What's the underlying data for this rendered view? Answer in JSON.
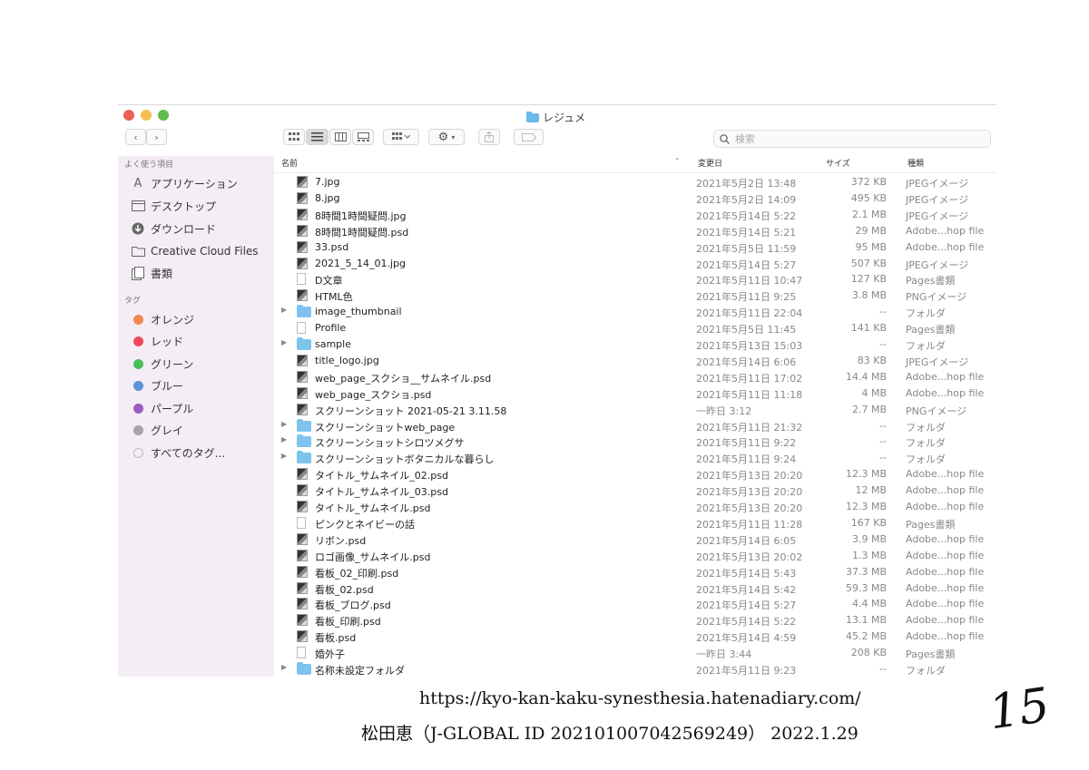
{
  "window": {
    "title": "レジュメ"
  },
  "toolbar": {
    "search_placeholder": "検索",
    "back_label": "‹",
    "forward_label": "›"
  },
  "sidebar": {
    "favorites_header": "よく使う項目",
    "favorites": [
      {
        "label": "アプリケーション",
        "icon": "applications-icon"
      },
      {
        "label": "デスクトップ",
        "icon": "desktop-icon"
      },
      {
        "label": "ダウンロード",
        "icon": "downloads-icon"
      },
      {
        "label": "Creative Cloud Files",
        "icon": "folder-icon"
      },
      {
        "label": "書類",
        "icon": "documents-icon"
      }
    ],
    "tags_header": "タグ",
    "tags": [
      {
        "label": "オレンジ",
        "color": "#f0874f"
      },
      {
        "label": "レッド",
        "color": "#ec4a5c"
      },
      {
        "label": "グリーン",
        "color": "#4cbf57"
      },
      {
        "label": "ブルー",
        "color": "#5a92d8"
      },
      {
        "label": "パープル",
        "color": "#9b5cc1"
      },
      {
        "label": "グレイ",
        "color": "#a5a5ab"
      },
      {
        "label": "すべてのタグ...",
        "color": ""
      }
    ]
  },
  "columns": {
    "name": "名前",
    "date": "変更日",
    "size": "サイズ",
    "kind": "種類"
  },
  "files": [
    {
      "name": "7.jpg",
      "date": "2021年5月2日 13:48",
      "size": "372 KB",
      "kind": "JPEGイメージ",
      "type": "image"
    },
    {
      "name": "8.jpg",
      "date": "2021年5月2日 14:09",
      "size": "495 KB",
      "kind": "JPEGイメージ",
      "type": "image"
    },
    {
      "name": "8時間1時間疑問.jpg",
      "date": "2021年5月14日 5:22",
      "size": "2.1 MB",
      "kind": "JPEGイメージ",
      "type": "image"
    },
    {
      "name": "8時間1時間疑問.psd",
      "date": "2021年5月14日 5:21",
      "size": "29 MB",
      "kind": "Adobe...hop file",
      "type": "image"
    },
    {
      "name": "33.psd",
      "date": "2021年5月5日 11:59",
      "size": "95 MB",
      "kind": "Adobe...hop file",
      "type": "image"
    },
    {
      "name": "2021_5_14_01.jpg",
      "date": "2021年5月14日 5:27",
      "size": "507 KB",
      "kind": "JPEGイメージ",
      "type": "image"
    },
    {
      "name": "D文章",
      "date": "2021年5月11日 10:47",
      "size": "127 KB",
      "kind": "Pages書類",
      "type": "file"
    },
    {
      "name": "HTML色",
      "date": "2021年5月11日 9:25",
      "size": "3.8 MB",
      "kind": "PNGイメージ",
      "type": "image"
    },
    {
      "name": "image_thumbnail",
      "date": "2021年5月11日 22:04",
      "size": "--",
      "kind": "フォルダ",
      "type": "folder"
    },
    {
      "name": "Profile",
      "date": "2021年5月5日 11:45",
      "size": "141 KB",
      "kind": "Pages書類",
      "type": "file"
    },
    {
      "name": "sample",
      "date": "2021年5月13日 15:03",
      "size": "--",
      "kind": "フォルダ",
      "type": "folder"
    },
    {
      "name": "title_logo.jpg",
      "date": "2021年5月14日 6:06",
      "size": "83 KB",
      "kind": "JPEGイメージ",
      "type": "image"
    },
    {
      "name": "web_page_スクショ__サムネイル.psd",
      "date": "2021年5月11日 17:02",
      "size": "14.4 MB",
      "kind": "Adobe...hop file",
      "type": "image"
    },
    {
      "name": "web_page_スクショ.psd",
      "date": "2021年5月11日 11:18",
      "size": "4 MB",
      "kind": "Adobe...hop file",
      "type": "image"
    },
    {
      "name": "スクリーンショット 2021-05-21 3.11.58",
      "date": "一昨日 3:12",
      "size": "2.7 MB",
      "kind": "PNGイメージ",
      "type": "image"
    },
    {
      "name": "スクリーンショットweb_page",
      "date": "2021年5月11日 21:32",
      "size": "--",
      "kind": "フォルダ",
      "type": "folder"
    },
    {
      "name": "スクリーンショットシロツメグサ",
      "date": "2021年5月11日 9:22",
      "size": "--",
      "kind": "フォルダ",
      "type": "folder"
    },
    {
      "name": "スクリーンショットボタニカルな暮らし",
      "date": "2021年5月11日 9:24",
      "size": "--",
      "kind": "フォルダ",
      "type": "folder"
    },
    {
      "name": "タイトル_サムネイル_02.psd",
      "date": "2021年5月13日 20:20",
      "size": "12.3 MB",
      "kind": "Adobe...hop file",
      "type": "image"
    },
    {
      "name": "タイトル_サムネイル_03.psd",
      "date": "2021年5月13日 20:20",
      "size": "12 MB",
      "kind": "Adobe...hop file",
      "type": "image"
    },
    {
      "name": "タイトル_サムネイル.psd",
      "date": "2021年5月13日 20:20",
      "size": "12.3 MB",
      "kind": "Adobe...hop file",
      "type": "image"
    },
    {
      "name": "ピンクとネイビーの話",
      "date": "2021年5月11日 11:28",
      "size": "167 KB",
      "kind": "Pages書類",
      "type": "file"
    },
    {
      "name": "リボン.psd",
      "date": "2021年5月14日 6:05",
      "size": "3.9 MB",
      "kind": "Adobe...hop file",
      "type": "image"
    },
    {
      "name": "ロゴ画像_サムネイル.psd",
      "date": "2021年5月13日 20:02",
      "size": "1.3 MB",
      "kind": "Adobe...hop file",
      "type": "image"
    },
    {
      "name": "看板_02_印刷.psd",
      "date": "2021年5月14日 5:43",
      "size": "37.3 MB",
      "kind": "Adobe...hop file",
      "type": "image"
    },
    {
      "name": "看板_02.psd",
      "date": "2021年5月14日 5:42",
      "size": "59.3 MB",
      "kind": "Adobe...hop file",
      "type": "image"
    },
    {
      "name": "看板_ブログ.psd",
      "date": "2021年5月14日 5:27",
      "size": "4.4 MB",
      "kind": "Adobe...hop file",
      "type": "image"
    },
    {
      "name": "看板_印刷.psd",
      "date": "2021年5月14日 5:22",
      "size": "13.1 MB",
      "kind": "Adobe...hop file",
      "type": "image"
    },
    {
      "name": "看板.psd",
      "date": "2021年5月14日 4:59",
      "size": "45.2 MB",
      "kind": "Adobe...hop file",
      "type": "image"
    },
    {
      "name": "婚外子",
      "date": "一昨日 3:44",
      "size": "208 KB",
      "kind": "Pages書類",
      "type": "file"
    },
    {
      "name": "名称未設定フォルダ",
      "date": "2021年5月11日 9:23",
      "size": "--",
      "kind": "フォルダ",
      "type": "folder"
    }
  ],
  "footer": {
    "url": "https://kyo-kan-kaku-synesthesia.hatenadiary.com/",
    "credit": "松田恵（J-GLOBAL ID 202101007042569249） 2022.1.29",
    "page_number": "15"
  }
}
